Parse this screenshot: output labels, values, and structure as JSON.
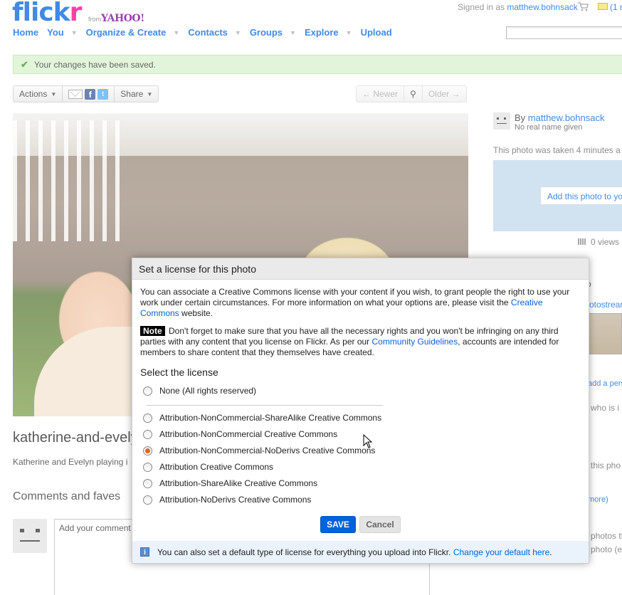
{
  "header": {
    "logo": {
      "part1": "flick",
      "part2": "r",
      "from": "from",
      "brand": "YAHOO!"
    },
    "signed_in_prefix": "Signed in as",
    "username": "matthew.bohnsack",
    "mail_count": "(1 n"
  },
  "nav": {
    "items": [
      {
        "label": "Home",
        "caret": false
      },
      {
        "label": "You",
        "caret": true
      },
      {
        "label": "Organize & Create",
        "caret": true
      },
      {
        "label": "Contacts",
        "caret": true
      },
      {
        "label": "Groups",
        "caret": true
      },
      {
        "label": "Explore",
        "caret": true
      },
      {
        "label": "Upload",
        "caret": false
      }
    ]
  },
  "notice": {
    "text": "Your changes have been saved."
  },
  "toolbar": {
    "actions": "Actions",
    "share": "Share",
    "newer": "Newer",
    "older": "Older"
  },
  "photo": {
    "title": "katherine-and-evely",
    "description": "Katherine and Evelyn playing i"
  },
  "comments": {
    "heading": "Comments and faves",
    "placeholder": "Add your comment"
  },
  "sidebar": {
    "by_prefix": "By",
    "owner": "matthew.bohnsack",
    "realname": "No real name given",
    "taken": "This photo was taken 4 minutes a",
    "map_button": "Add this photo to yo",
    "views": "0 views",
    "frag_letter": "o",
    "frag_photostream": "otostream",
    "frag_add_person": "add a pers",
    "frag_who": "who is i",
    "frag_this_photo": "this pho",
    "frag_more": "more)",
    "frag_photos": "photos th",
    "frag_photo_ed": "photo (e"
  },
  "dialog": {
    "title": "Set a license for this photo",
    "intro": "You can associate a Creative Commons license with your content if you wish, to grant people the right to use your work under certain circumstances. For more information on what your options are, please visit the",
    "intro_link": "Creative Commons",
    "intro_end": "website.",
    "note_label": "Note",
    "note_text": "Don't forget to make sure that you have all the necessary rights and you won't be infringing on any third parties with any content that you license on Flickr. As per our",
    "note_link": "Community Guidelines",
    "note_end": ", accounts are intended for members to share content that they themselves have created.",
    "select_heading": "Select the license",
    "options": [
      {
        "label": "None (All rights reserved)",
        "selected": false
      },
      {
        "label": "Attribution-NonCommercial-ShareAlike Creative Commons",
        "selected": false
      },
      {
        "label": "Attribution-NonCommercial Creative Commons",
        "selected": false
      },
      {
        "label": "Attribution-NonCommercial-NoDerivs Creative Commons",
        "selected": true
      },
      {
        "label": "Attribution Creative Commons",
        "selected": false
      },
      {
        "label": "Attribution-ShareAlike Creative Commons",
        "selected": false
      },
      {
        "label": "Attribution-NoDerivs Creative Commons",
        "selected": false
      }
    ],
    "save": "SAVE",
    "cancel": "Cancel",
    "footer_text": "You can also set a default type of license for everything you upload into Flickr.",
    "footer_link": "Change your default here",
    "footer_end": "."
  },
  "colors": {
    "brand_blue": "#0063dc",
    "selected_radio": "#e8641d",
    "notice_bg": "#d9f2ce"
  },
  "icons": [
    "check-icon",
    "cart-icon",
    "mail-icon",
    "email-share-icon",
    "facebook-icon",
    "twitter-icon",
    "arrow-left-icon",
    "zoom-icon",
    "arrow-right-icon",
    "info-icon",
    "mouse-cursor-icon"
  ]
}
